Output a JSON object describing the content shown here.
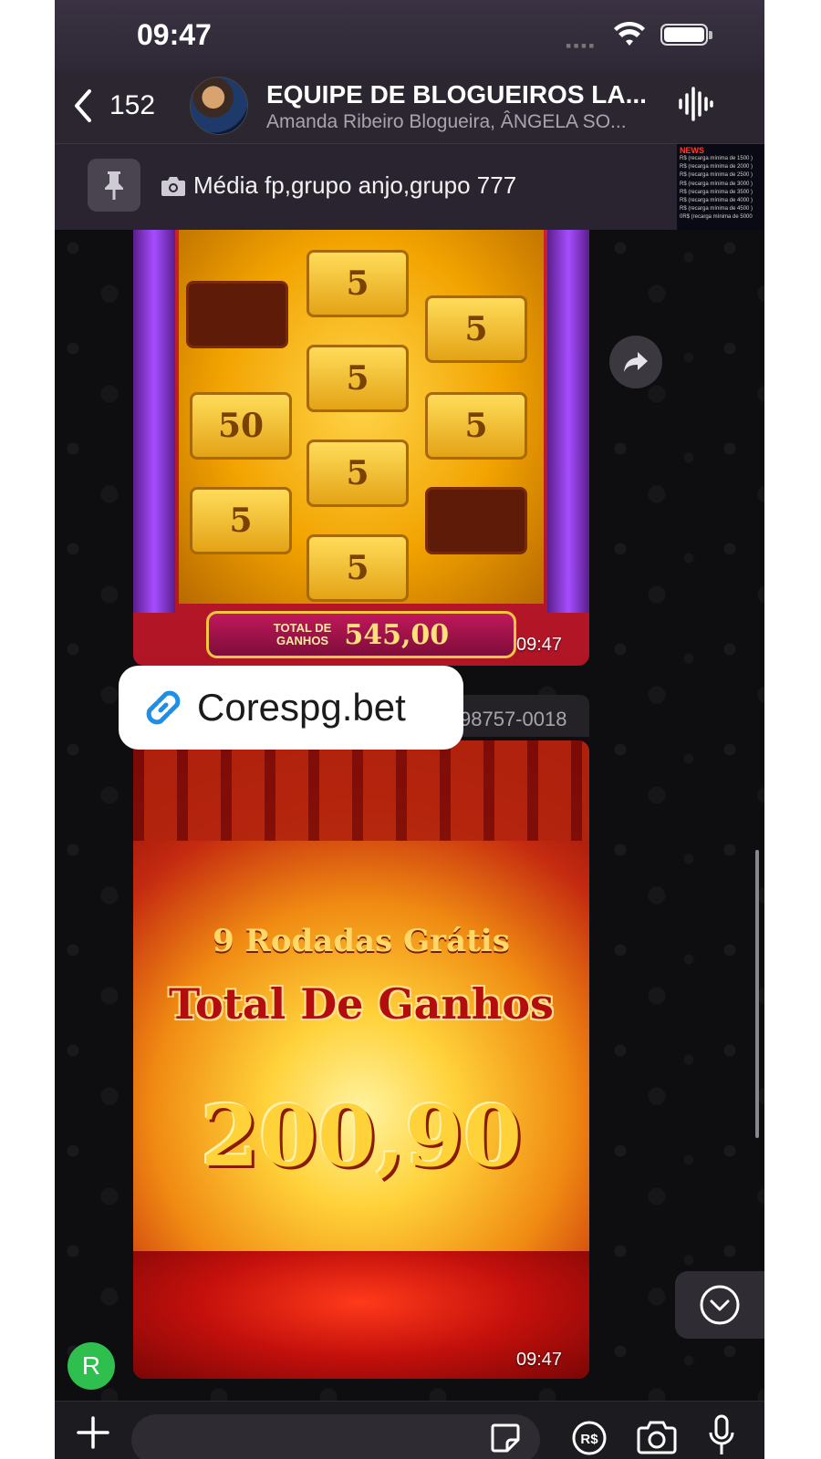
{
  "status_bar": {
    "time": "09:47"
  },
  "header": {
    "back_count": "152",
    "title": "EQUIPE DE BLOGUEIROS LA...",
    "subtitle": "Amanda Ribeiro Blogueira, ÂNGELA SO..."
  },
  "pinned": {
    "text": "Média fp,grupo anjo,grupo 777",
    "thumb_title": "NEWS",
    "thumb_lines": [
      "R$ (recarga mínima de 1500 )",
      "R$ (recarga mínima de 2000 )",
      "R$ (recarga mínima de 2500 )",
      "R$ (recarga mínima de 3000 )",
      "R$ (recarga mínima de 3500 )",
      "R$ (recarga mínima de 4000 )",
      "R$ (recarga mínima de 4500 )",
      "0R$ (recarga mínima de 5000"
    ]
  },
  "messages": [
    {
      "type": "image",
      "tiles": [
        "5",
        "5",
        "5",
        "50",
        "5",
        "5",
        "5",
        "5"
      ],
      "win_label_line1": "TOTAL DE",
      "win_label_line2": "GANHOS",
      "win_value": "545,00",
      "time": "09:47"
    },
    {
      "type": "image",
      "sender_phone_partial": "98757-0018",
      "bonus_line1": "9 Rodadas Grátis",
      "bonus_line2": "Total De Ganhos",
      "bonus_amount": "200,90",
      "time": "09:47"
    }
  ],
  "link_overlay": {
    "text": "Corespg.bet"
  },
  "sender_avatar_initial": "R",
  "input": {
    "placeholder": ""
  },
  "colors": {
    "accent_green": "#2fbf4f",
    "header_bg": "#2b2630",
    "chat_bg": "#0e0e10"
  }
}
